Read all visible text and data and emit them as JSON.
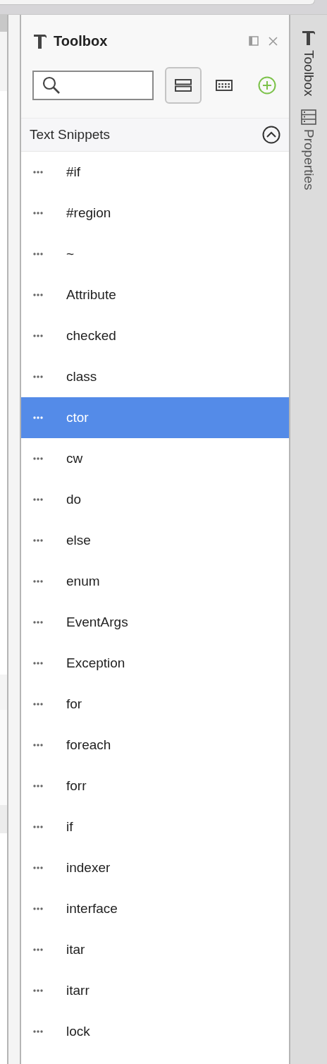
{
  "panel": {
    "title": "Toolbox"
  },
  "view_buttons": [
    {
      "kind": "list",
      "selected": true
    },
    {
      "kind": "grid",
      "selected": false
    }
  ],
  "section": {
    "title": "Text Snippets",
    "expanded": true
  },
  "items": [
    {
      "label": "#if",
      "selected": false
    },
    {
      "label": "#region",
      "selected": false
    },
    {
      "label": "~",
      "selected": false
    },
    {
      "label": "Attribute",
      "selected": false
    },
    {
      "label": "checked",
      "selected": false
    },
    {
      "label": "class",
      "selected": false
    },
    {
      "label": "ctor",
      "selected": true
    },
    {
      "label": "cw",
      "selected": false
    },
    {
      "label": "do",
      "selected": false
    },
    {
      "label": "else",
      "selected": false
    },
    {
      "label": "enum",
      "selected": false
    },
    {
      "label": "EventArgs",
      "selected": false
    },
    {
      "label": "Exception",
      "selected": false
    },
    {
      "label": "for",
      "selected": false
    },
    {
      "label": "foreach",
      "selected": false
    },
    {
      "label": "forr",
      "selected": false
    },
    {
      "label": "if",
      "selected": false
    },
    {
      "label": "indexer",
      "selected": false
    },
    {
      "label": "interface",
      "selected": false
    },
    {
      "label": "itar",
      "selected": false
    },
    {
      "label": "itarr",
      "selected": false
    },
    {
      "label": "lock",
      "selected": false
    }
  ],
  "side_tabs": [
    {
      "label": "Toolbox",
      "kind": "toolbox",
      "selected": true
    },
    {
      "label": "Properties",
      "kind": "properties",
      "selected": false
    }
  ]
}
